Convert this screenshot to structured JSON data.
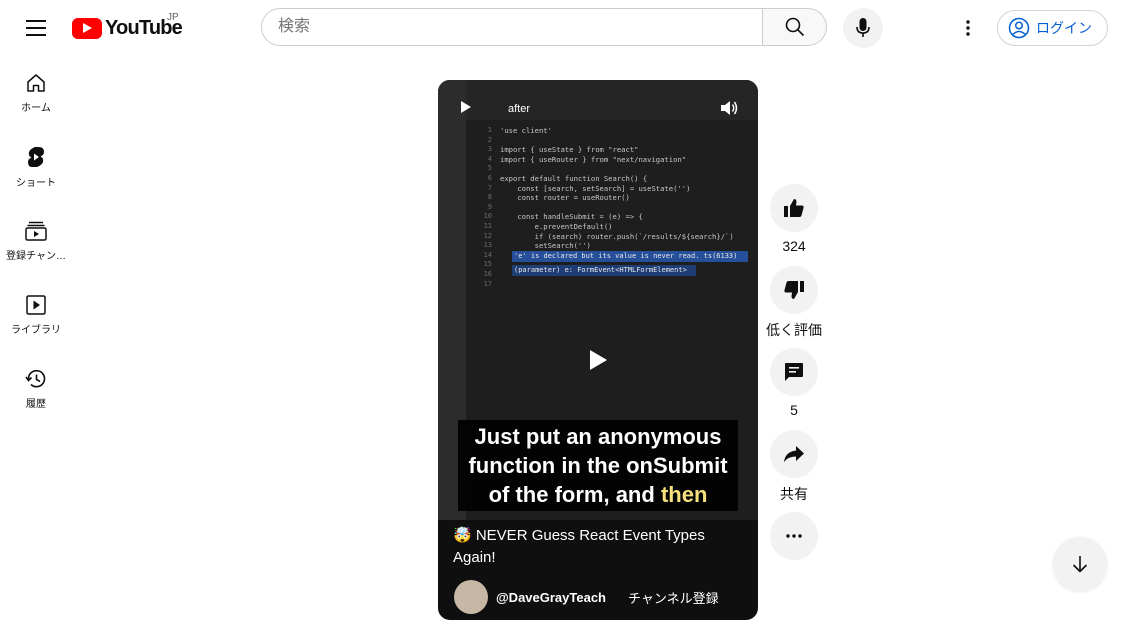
{
  "header": {
    "logo_text": "YouTube",
    "region": "JP",
    "search_placeholder": "検索",
    "login_label": "ログイン"
  },
  "sidebar": {
    "items": [
      {
        "label": "ホーム",
        "icon": "home-icon"
      },
      {
        "label": "ショート",
        "icon": "shorts-icon"
      },
      {
        "label": "登録チャン…",
        "icon": "subscriptions-icon"
      },
      {
        "label": "ライブラリ",
        "icon": "library-icon"
      },
      {
        "label": "履歴",
        "icon": "history-icon"
      }
    ]
  },
  "video": {
    "overlay_label": "after",
    "caption_line1": "Just put an anonymous",
    "caption_line2": "function in the onSubmit",
    "caption_line3": "of the form, and",
    "caption_highlight": "then",
    "title": "🤯 NEVER Guess React Event Types Again!",
    "channel": "@DaveGrayTeach",
    "subscribe_label": "チャンネル登録",
    "code_hint1": "'e' is declared but its value is never read. ts(6133)",
    "code_hint2": "(parameter) e: FormEvent<HTMLFormElement>"
  },
  "actions": {
    "like_count": "324",
    "dislike_label": "低く評価",
    "comment_count": "5",
    "share_label": "共有"
  },
  "colors": {
    "brand_red": "#ff0000",
    "link_blue": "#065fd4",
    "caption_yellow": "#f6e07c"
  }
}
